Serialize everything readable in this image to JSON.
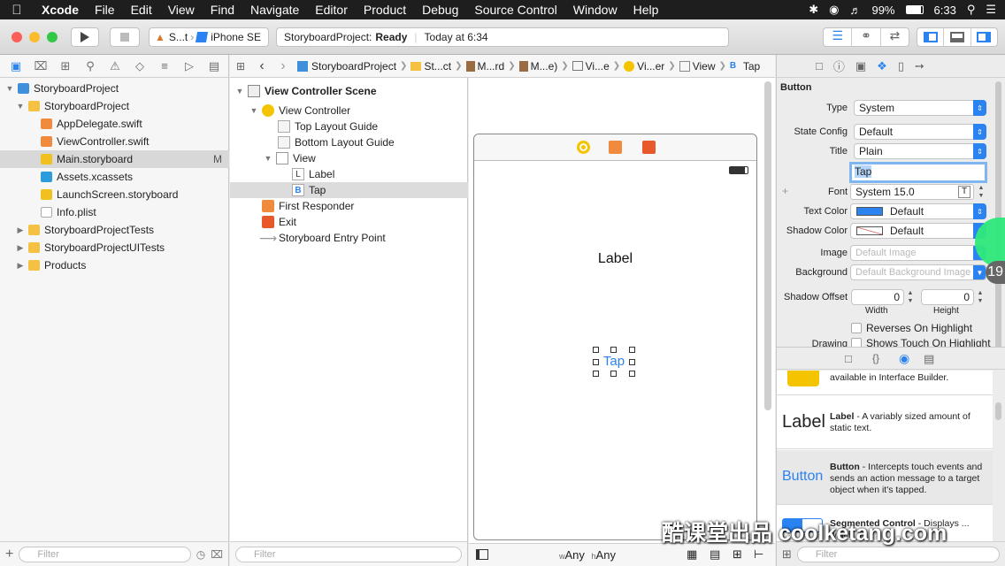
{
  "menubar": {
    "app": "Xcode",
    "items": [
      "File",
      "Edit",
      "View",
      "Find",
      "Navigate",
      "Editor",
      "Product",
      "Debug",
      "Source Control",
      "Window",
      "Help"
    ],
    "battery": "99%",
    "clock": "6:33"
  },
  "toolbar": {
    "scheme": "S...t",
    "device": "iPhone SE",
    "status_project": "StoryboardProject:",
    "status_state": "Ready",
    "status_time": "Today at 6:34"
  },
  "navigator": {
    "items": [
      {
        "label": "StoryboardProject"
      },
      {
        "label": "StoryboardProject"
      },
      {
        "label": "AppDelegate.swift"
      },
      {
        "label": "ViewController.swift"
      },
      {
        "label": "Main.storyboard",
        "badge": "M"
      },
      {
        "label": "Assets.xcassets"
      },
      {
        "label": "LaunchScreen.storyboard"
      },
      {
        "label": "Info.plist"
      },
      {
        "label": "StoryboardProjectTests"
      },
      {
        "label": "StoryboardProjectUITests"
      },
      {
        "label": "Products"
      }
    ],
    "filter_placeholder": "Filter"
  },
  "jumpbar": {
    "crumbs": [
      "StoryboardProject",
      "St...ct",
      "M...rd",
      "M...e)",
      "Vi...e",
      "Vi...er",
      "View",
      "Tap"
    ]
  },
  "outline": {
    "rows": [
      {
        "label": "View Controller Scene"
      },
      {
        "label": "View Controller"
      },
      {
        "label": "Top Layout Guide"
      },
      {
        "label": "Bottom Layout Guide"
      },
      {
        "label": "View"
      },
      {
        "label": "Label",
        "glyph": "L"
      },
      {
        "label": "Tap",
        "glyph": "B"
      },
      {
        "label": "First Responder"
      },
      {
        "label": "Exit"
      },
      {
        "label": "Storyboard Entry Point"
      }
    ],
    "filter_placeholder": "Filter"
  },
  "canvas": {
    "label_text": "Label",
    "button_text": "Tap",
    "size_w_prefix": "w",
    "size_w": "Any",
    "size_h_prefix": "h",
    "size_h": "Any"
  },
  "inspector": {
    "section": "Button",
    "type_label": "Type",
    "type_value": "System",
    "state_label": "State Config",
    "state_value": "Default",
    "title_label": "Title",
    "title_value": "Plain",
    "title_text": "Tap",
    "font_label": "Font",
    "font_value": "System 15.0",
    "text_color_label": "Text Color",
    "text_color_value": "Default",
    "shadow_color_label": "Shadow Color",
    "shadow_color_value": "Default",
    "image_label": "Image",
    "image_placeholder": "Default Image",
    "background_label": "Background",
    "background_placeholder": "Default Background Image",
    "shadow_offset_label": "Shadow Offset",
    "shadow_w": "0",
    "shadow_h": "0",
    "width_label": "Width",
    "height_label": "Height",
    "reverses_label": "Reverses On Highlight",
    "drawing_label": "Drawing",
    "shows_touch_label": "Shows Touch On Highlight",
    "badge": "19"
  },
  "library": {
    "first_desc": "available in Interface Builder.",
    "items": [
      {
        "preview": "Label",
        "name": "Label",
        "desc": " - A variably sized amount of static text."
      },
      {
        "preview": "Button",
        "name": "Button",
        "desc": " - Intercepts touch events and sends an action message to a target object when it's tapped."
      },
      {
        "name": "Segmented Control",
        "desc": " - Displays ... which"
      }
    ],
    "filter_placeholder": "Filter"
  },
  "watermark": "酷课堂出品 coolketang.com",
  "colors": {
    "accent": "#2a83f0",
    "traffic_red": "#fc5f57",
    "traffic_yellow": "#fdbc2e",
    "traffic_green": "#33c748",
    "touch_indicator": "#2ee87a"
  }
}
